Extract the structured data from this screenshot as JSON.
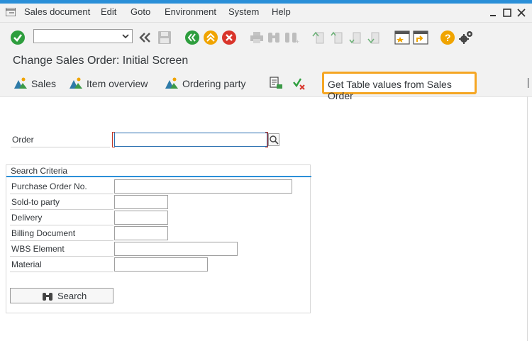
{
  "menu": {
    "items": [
      "Sales document",
      "Edit",
      "Goto",
      "Environment",
      "System",
      "Help"
    ]
  },
  "toolbar": {
    "command_value": ""
  },
  "title": "Change Sales Order: Initial Screen",
  "app_toolbar": {
    "sales": "Sales",
    "item_overview": "Item overview",
    "ordering_party": "Ordering party",
    "get_table_values": "Get Table values from Sales Order"
  },
  "order": {
    "label": "Order",
    "value": ""
  },
  "search_criteria": {
    "title": "Search Criteria",
    "fields": [
      {
        "label": "Purchase Order No.",
        "value": ""
      },
      {
        "label": "Sold-to party",
        "value": ""
      },
      {
        "label": "Delivery",
        "value": ""
      },
      {
        "label": "Billing Document",
        "value": ""
      },
      {
        "label": "WBS Element",
        "value": ""
      },
      {
        "label": "Material",
        "value": ""
      }
    ],
    "search_label": "Search"
  },
  "colors": {
    "accent": "#2a8fd8",
    "highlight": "#f5a623",
    "ok_green": "#2e9e3e",
    "cancel_red": "#d9352b",
    "help_orange": "#f0a400"
  }
}
